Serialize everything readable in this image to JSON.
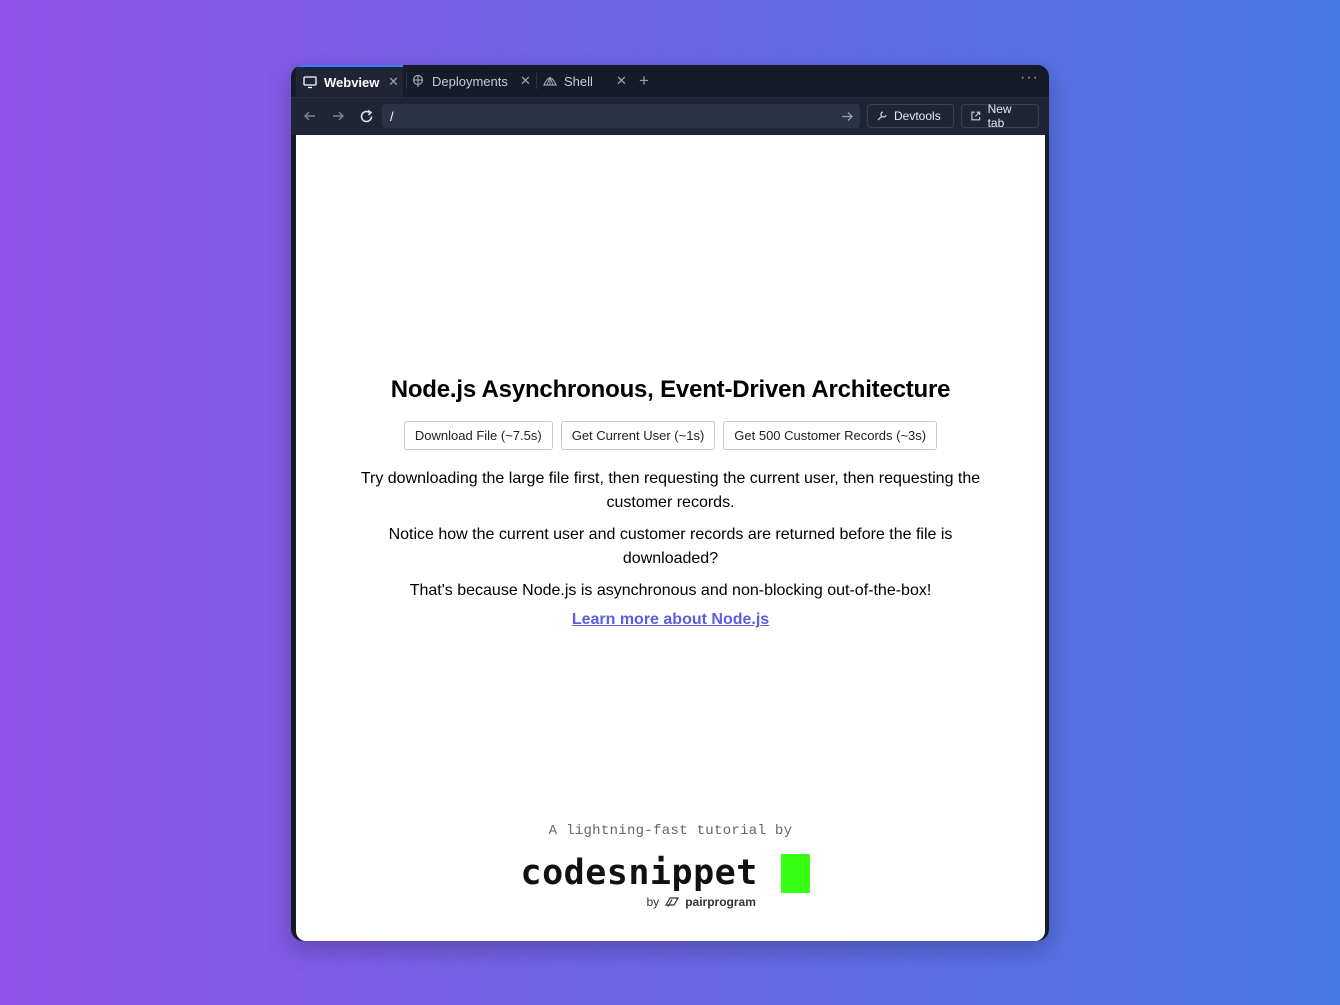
{
  "tabs": [
    {
      "label": "Webview",
      "icon": "monitor-icon",
      "active": true
    },
    {
      "label": "Deployments",
      "icon": "deployments-icon",
      "active": false
    },
    {
      "label": "Shell",
      "icon": "shell-icon",
      "active": false
    }
  ],
  "navbar": {
    "url": "/",
    "devtools_label": "Devtools",
    "new_tab_label": "New tab"
  },
  "page": {
    "title": "Node.js Asynchronous, Event-Driven Architecture",
    "buttons": [
      "Download File (~7.5s)",
      "Get Current User (~1s)",
      "Get 500 Customer Records (~3s)"
    ],
    "paragraphs": [
      "Try downloading the large file first, then requesting the current user, then requesting the customer records.",
      "Notice how the current user and customer records are returned before the file is downloaded?",
      "That's because Node.js is asynchronous and non-blocking out-of-the-box!"
    ],
    "link": "Learn more about Node.js"
  },
  "footer": {
    "tagline": "A lightning-fast tutorial by",
    "logo_text": "codesnippet",
    "by": "by",
    "brand": "pairprogram"
  },
  "colors": {
    "accent_green": "#39ff14",
    "link": "#5a5ee0",
    "active_tab_indicator": "#3d7ff2"
  }
}
